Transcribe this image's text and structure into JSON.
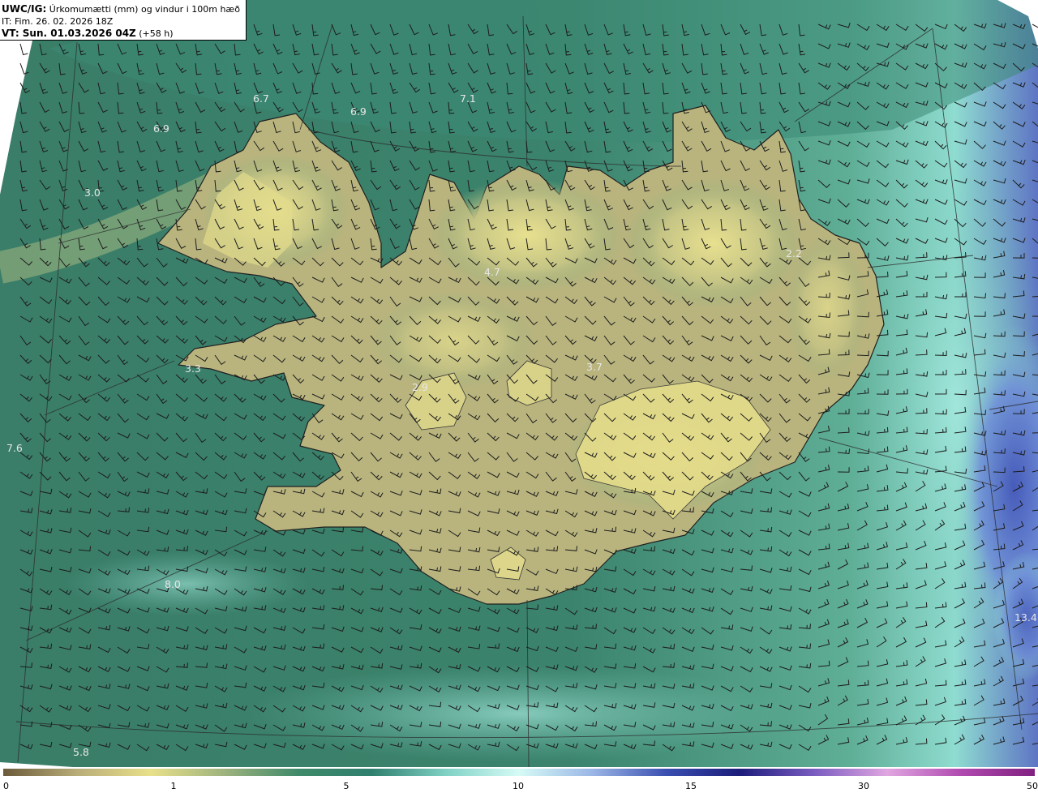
{
  "header": {
    "product": "UWC/IG:",
    "description": "Úrkomumætti (mm) og vindur i 100m hæð",
    "init_time": "IT: Fim. 26. 02. 2026 18Z",
    "valid_prefix": "VT: Sun. 01.03.2026 04Z",
    "valid_offset": "(+58 h)"
  },
  "value_labels": [
    "6.7",
    "6.9",
    "7.1",
    "6.9",
    "3.0",
    "3.3",
    "7.6",
    "8.0",
    "5.8",
    "4.7",
    "3.7",
    "2.2",
    "2.9",
    "13.4"
  ],
  "colorbar": {
    "ticks": [
      "0",
      "1",
      "5",
      "10",
      "15",
      "30",
      "50"
    ],
    "colors": [
      "#6b5a3a",
      "#b8ac78",
      "#e8e08a",
      "#9fb37e",
      "#3f8a6a",
      "#2f7f6e",
      "#7fd1c4",
      "#d6fbf6",
      "#9bb6e6",
      "#3a4fb0",
      "#1c1c7a",
      "#7a5cc0",
      "#e0a6e0",
      "#b04ab0",
      "#802080"
    ]
  },
  "colors": {
    "ocean_dark": "#2f6f5e",
    "ocean_mid": "#3f8a70",
    "land_low": "#9fb27e",
    "land_high": "#e6df8e",
    "high_precip": "#7fd6cc",
    "very_high_precip": "#4050b4"
  }
}
